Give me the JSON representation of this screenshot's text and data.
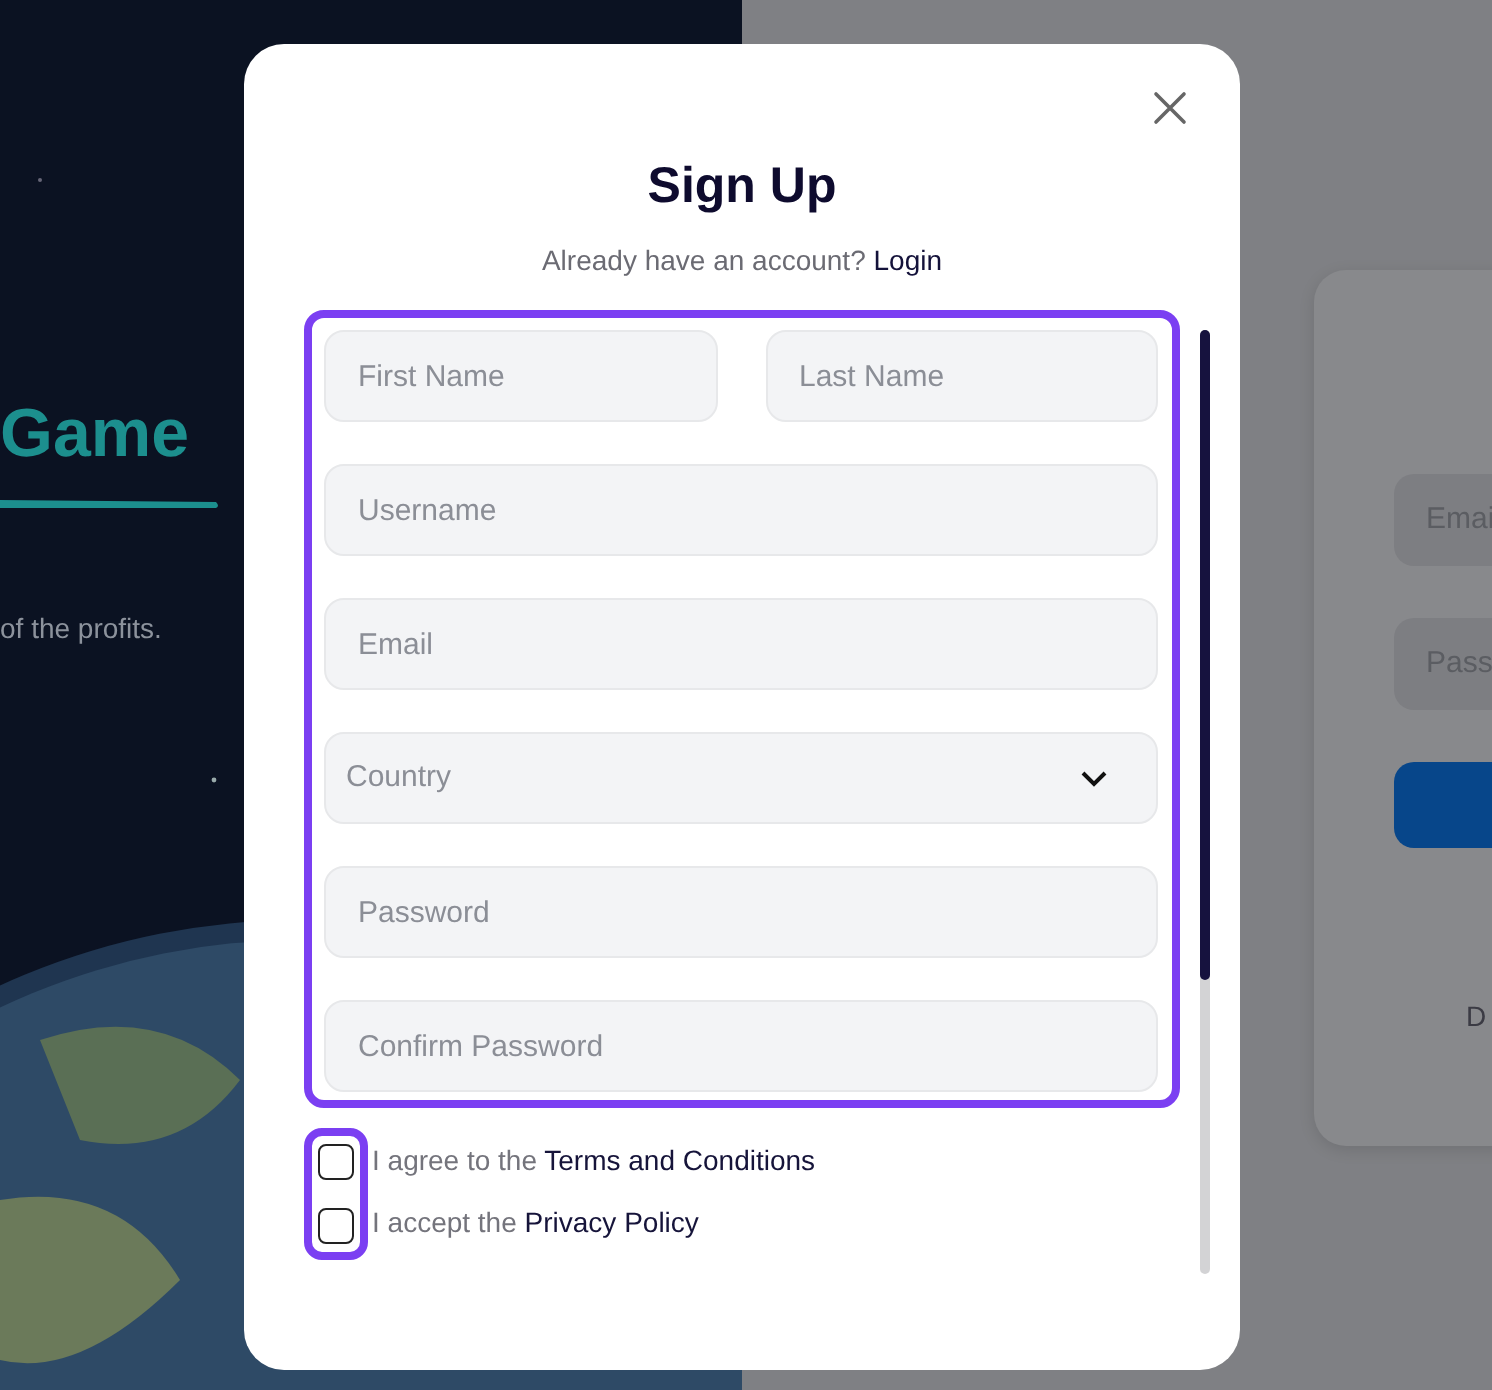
{
  "background": {
    "headline": "Game",
    "tagline": "of the profits.",
    "card": {
      "fields": [
        {
          "placeholder": "Emai"
        },
        {
          "placeholder": "Pass"
        }
      ],
      "footer": "D"
    }
  },
  "modal": {
    "title": "Sign Up",
    "subtitle": "Already have an account?",
    "login_link": "Login",
    "rows": [
      [
        {
          "placeholder": "First Name",
          "kind": "input"
        },
        {
          "placeholder": "Last Name",
          "kind": "input"
        }
      ],
      [
        {
          "placeholder": "Username",
          "kind": "input"
        }
      ],
      [
        {
          "placeholder": "Email",
          "kind": "input"
        }
      ],
      [
        {
          "placeholder": "Country",
          "kind": "select"
        }
      ],
      [
        {
          "placeholder": "Password",
          "kind": "input"
        }
      ],
      [
        {
          "placeholder": "Confirm Password",
          "kind": "input"
        }
      ]
    ],
    "checkboxes": [
      {
        "text": "I agree to the",
        "link": "Terms and Conditions",
        "checked": false
      },
      {
        "text": "I accept the",
        "link": "Privacy Policy",
        "checked": false
      }
    ]
  }
}
